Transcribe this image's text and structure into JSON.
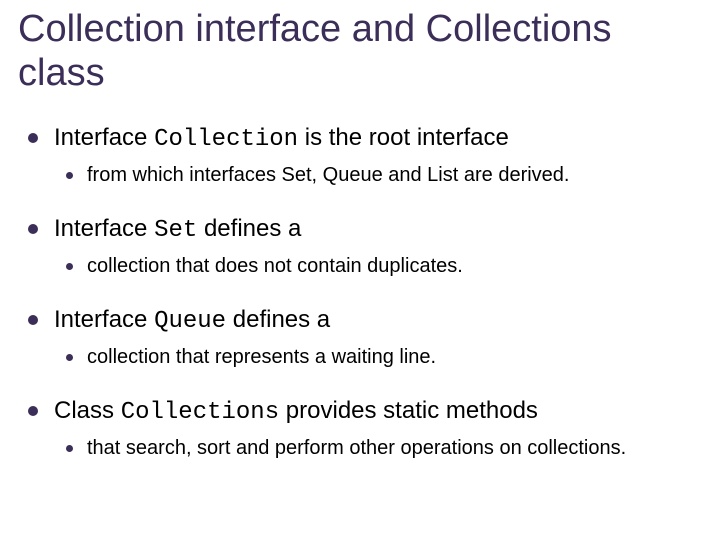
{
  "title": "Collection interface and Collections class",
  "bullets": [
    {
      "l1": {
        "pre": "Interface ",
        "code": "Collection",
        "post": " is the root interface"
      },
      "l2": "from which interfaces Set, Queue and List are derived."
    },
    {
      "l1": {
        "pre": "Interface ",
        "code": "Set",
        "post": " defines a"
      },
      "l2": "collection that does not contain duplicates."
    },
    {
      "l1": {
        "pre": "Interface ",
        "code": "Queue",
        "post": " defines a"
      },
      "l2": "collection that represents a waiting line."
    },
    {
      "l1": {
        "pre": "Class ",
        "code": "Collections",
        "post": " provides static methods"
      },
      "l2": "that search, sort and perform other operations on collections."
    }
  ]
}
